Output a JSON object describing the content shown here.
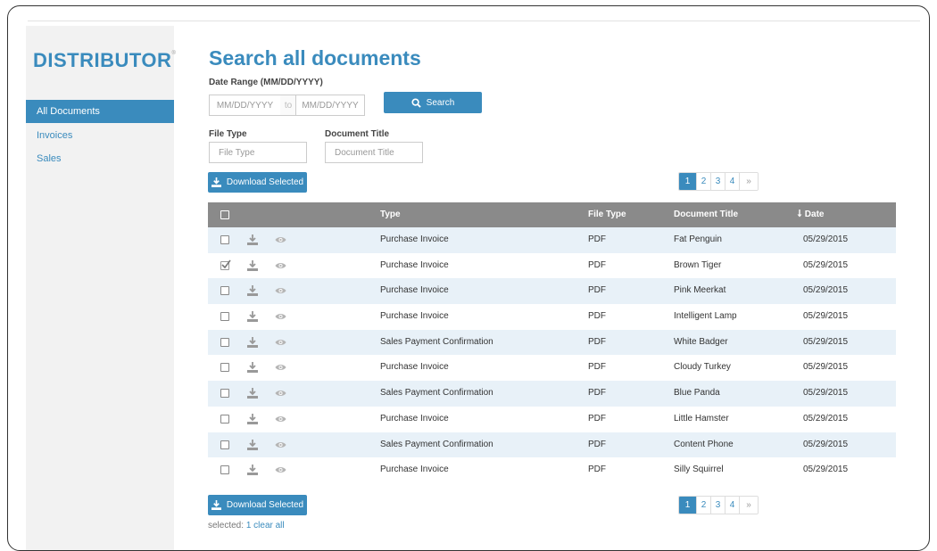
{
  "sidebar": {
    "logo": "DISTRIBUTOR",
    "logo_mark": "®",
    "items": [
      {
        "label": "All Documents",
        "active": true
      },
      {
        "label": "Invoices",
        "active": false
      },
      {
        "label": "Sales",
        "active": false
      }
    ]
  },
  "main": {
    "title": "Search all documents",
    "date_range_label": "Date Range (MM/DD/YYYY)",
    "date_from_placeholder": "MM/DD/YYYY",
    "date_to_separator": "to",
    "date_to_placeholder": "MM/DD/YYYY",
    "search_button": "Search",
    "file_type_label": "File Type",
    "file_type_placeholder": "File Type",
    "document_title_label": "Document Title",
    "document_title_placeholder": "Document Title",
    "download_selected": "Download Selected",
    "pagination": {
      "pages": [
        "1",
        "2",
        "3",
        "4"
      ],
      "current": "1",
      "next": "»"
    }
  },
  "table": {
    "headers": {
      "type": "Type",
      "file_type": "File Type",
      "document_title": "Document Title",
      "date": "Date",
      "date_sort_icon": "sort-down-arrow"
    },
    "rows": [
      {
        "type": "Purchase Invoice",
        "file_type": "PDF",
        "title": "Fat Penguin",
        "date": "05/29/2015",
        "checked": false
      },
      {
        "type": "Purchase Invoice",
        "file_type": "PDF",
        "title": "Brown Tiger",
        "date": "05/29/2015",
        "checked": true
      },
      {
        "type": "Purchase Invoice",
        "file_type": "PDF",
        "title": "Pink Meerkat",
        "date": "05/29/2015",
        "checked": false
      },
      {
        "type": "Purchase Invoice",
        "file_type": "PDF",
        "title": "Intelligent Lamp",
        "date": "05/29/2015",
        "checked": false
      },
      {
        "type": "Sales Payment Confirmation",
        "file_type": "PDF",
        "title": "White Badger",
        "date": "05/29/2015",
        "checked": false
      },
      {
        "type": "Purchase Invoice",
        "file_type": "PDF",
        "title": "Cloudy Turkey",
        "date": "05/29/2015",
        "checked": false
      },
      {
        "type": "Sales Payment Confirmation",
        "file_type": "PDF",
        "title": "Blue Panda",
        "date": "05/29/2015",
        "checked": false
      },
      {
        "type": "Purchase Invoice",
        "file_type": "PDF",
        "title": "Little Hamster",
        "date": "05/29/2015",
        "checked": false
      },
      {
        "type": "Sales Payment Confirmation",
        "file_type": "PDF",
        "title": "Content Phone",
        "date": "05/29/2015",
        "checked": false
      },
      {
        "type": "Purchase Invoice",
        "file_type": "PDF",
        "title": "Silly Squirrel",
        "date": "05/29/2015",
        "checked": false
      }
    ]
  },
  "footer": {
    "selected_prefix": "selected:",
    "selected_count": "1",
    "clear_all": "clear all"
  },
  "colors": {
    "accent": "#3a8bbd",
    "header_bg": "#8a8a8a",
    "row_alt": "#e8f1f8"
  }
}
